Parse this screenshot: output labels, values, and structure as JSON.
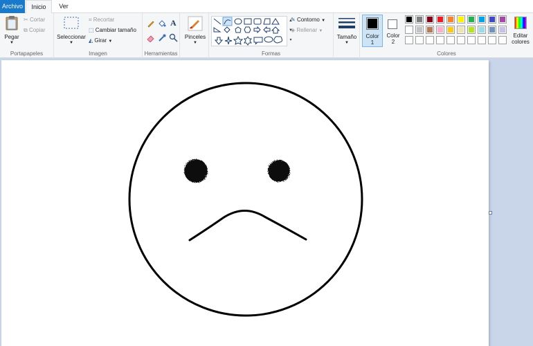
{
  "tabs": {
    "file": "Archivo",
    "home": "Inicio",
    "view": "Ver"
  },
  "clipboard": {
    "paste": "Pegar",
    "cut": "Cortar",
    "copy": "Copiar",
    "group": "Portapapeles"
  },
  "image": {
    "select": "Seleccionar",
    "crop": "Recortar",
    "resize": "Cambiar tamaño",
    "rotate": "Girar",
    "group": "Imagen"
  },
  "tools": {
    "group": "Herramientas",
    "text_glyph": "A"
  },
  "brushes": {
    "label": "Pinceles"
  },
  "shapes": {
    "outline": "Contorno",
    "fill": "Rellenar",
    "group": "Formas"
  },
  "size": {
    "label": "Tamaño"
  },
  "colors": {
    "color1_line1": "Color",
    "color1_line2": "1",
    "color2_line1": "Color",
    "color2_line2": "2",
    "edit_line1": "Editar",
    "edit_line2": "colores",
    "group": "Colores",
    "color1_value": "#000000",
    "color2_value": "#ffffff",
    "palette_row1": [
      "#000000",
      "#7f7f7f",
      "#880015",
      "#ed1c24",
      "#ff7f27",
      "#fff200",
      "#22b14c",
      "#00a2e8",
      "#3f48cc",
      "#a349a4"
    ],
    "palette_row2": [
      "#ffffff",
      "#c3c3c3",
      "#b97a57",
      "#ffaec9",
      "#ffc90e",
      "#efe4b0",
      "#b5e61d",
      "#99d9ea",
      "#7092be",
      "#c8bfe7"
    ],
    "palette_row3_count": 10
  }
}
